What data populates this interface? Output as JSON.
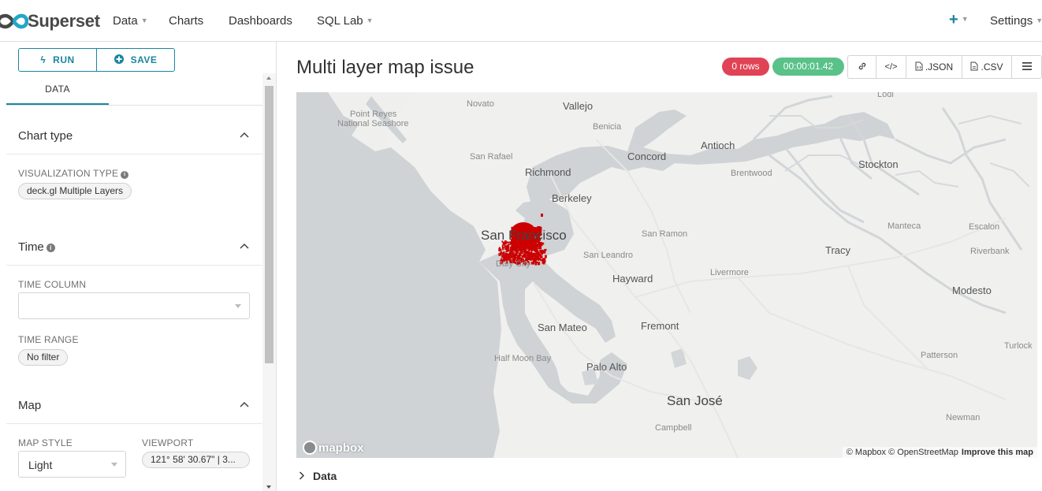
{
  "nav": {
    "brand": "Superset",
    "items": [
      {
        "label": "Data",
        "dropdown": true
      },
      {
        "label": "Charts",
        "dropdown": false
      },
      {
        "label": "Dashboards",
        "dropdown": false
      },
      {
        "label": "SQL Lab",
        "dropdown": true
      }
    ],
    "plus_label": "+",
    "settings_label": "Settings"
  },
  "colors": {
    "accent": "#1a85a0",
    "error_badge": "#e04355",
    "success_badge": "#5ac189",
    "map_points": "#cc0000"
  },
  "left_panel": {
    "run_label": "RUN",
    "save_label": "SAVE",
    "tab_label": "DATA",
    "sections": {
      "chart_type": {
        "title": "Chart type",
        "viz_type_label": "VISUALIZATION TYPE",
        "viz_type_value": "deck.gl Multiple Layers"
      },
      "time": {
        "title": "Time",
        "time_column_label": "TIME COLUMN",
        "time_column_value": "",
        "time_range_label": "TIME RANGE",
        "time_range_value": "No filter"
      },
      "map": {
        "title": "Map",
        "map_style_label": "MAP STYLE",
        "map_style_value": "Light",
        "viewport_label": "VIEWPORT",
        "viewport_value": "121° 58' 30.67\" | 3..."
      }
    }
  },
  "chart": {
    "title": "Multi layer map issue",
    "rows_badge": "0 rows",
    "time_badge": "00:00:01.42",
    "toolbar": {
      "json_label": ".JSON",
      "csv_label": ".CSV"
    },
    "map_labels": [
      {
        "text": "Lodi",
        "size": "sm"
      },
      {
        "text": "Novato",
        "size": "sm"
      },
      {
        "text": "Vallejo",
        "size": "med"
      },
      {
        "text": "Point Reyes",
        "size": "sm"
      },
      {
        "text": "National Seashore",
        "size": "sm"
      },
      {
        "text": "Benicia",
        "size": "sm"
      },
      {
        "text": "Antioch",
        "size": "med"
      },
      {
        "text": "Concord",
        "size": "med"
      },
      {
        "text": "San Rafael",
        "size": "sm"
      },
      {
        "text": "Richmond",
        "size": "med"
      },
      {
        "text": "Brentwood",
        "size": "sm"
      },
      {
        "text": "Stockton",
        "size": "med"
      },
      {
        "text": "Berkeley",
        "size": "med"
      },
      {
        "text": "San Francisco",
        "size": "city"
      },
      {
        "text": "San Ramon",
        "size": "sm"
      },
      {
        "text": "Manteca",
        "size": "sm"
      },
      {
        "text": "Escalon",
        "size": "sm"
      },
      {
        "text": "Tracy",
        "size": "med"
      },
      {
        "text": "Riverbank",
        "size": "sm"
      },
      {
        "text": "San Leandro",
        "size": "sm"
      },
      {
        "text": "Daly City",
        "size": "sm"
      },
      {
        "text": "Hayward",
        "size": "med"
      },
      {
        "text": "Livermore",
        "size": "sm"
      },
      {
        "text": "Modesto",
        "size": "med"
      },
      {
        "text": "San Mateo",
        "size": "med"
      },
      {
        "text": "Fremont",
        "size": "med"
      },
      {
        "text": "Turlock",
        "size": "sm"
      },
      {
        "text": "Half Moon Bay",
        "size": "sm"
      },
      {
        "text": "Palo Alto",
        "size": "med"
      },
      {
        "text": "Patterson",
        "size": "sm"
      },
      {
        "text": "San José",
        "size": "city"
      },
      {
        "text": "Newman",
        "size": "sm"
      },
      {
        "text": "Campbell",
        "size": "sm"
      }
    ],
    "mapbox_logo_text": "mapbox",
    "attribution": "© Mapbox © OpenStreetMap",
    "improve_link": "Improve this map",
    "data_toggle_label": "Data"
  }
}
